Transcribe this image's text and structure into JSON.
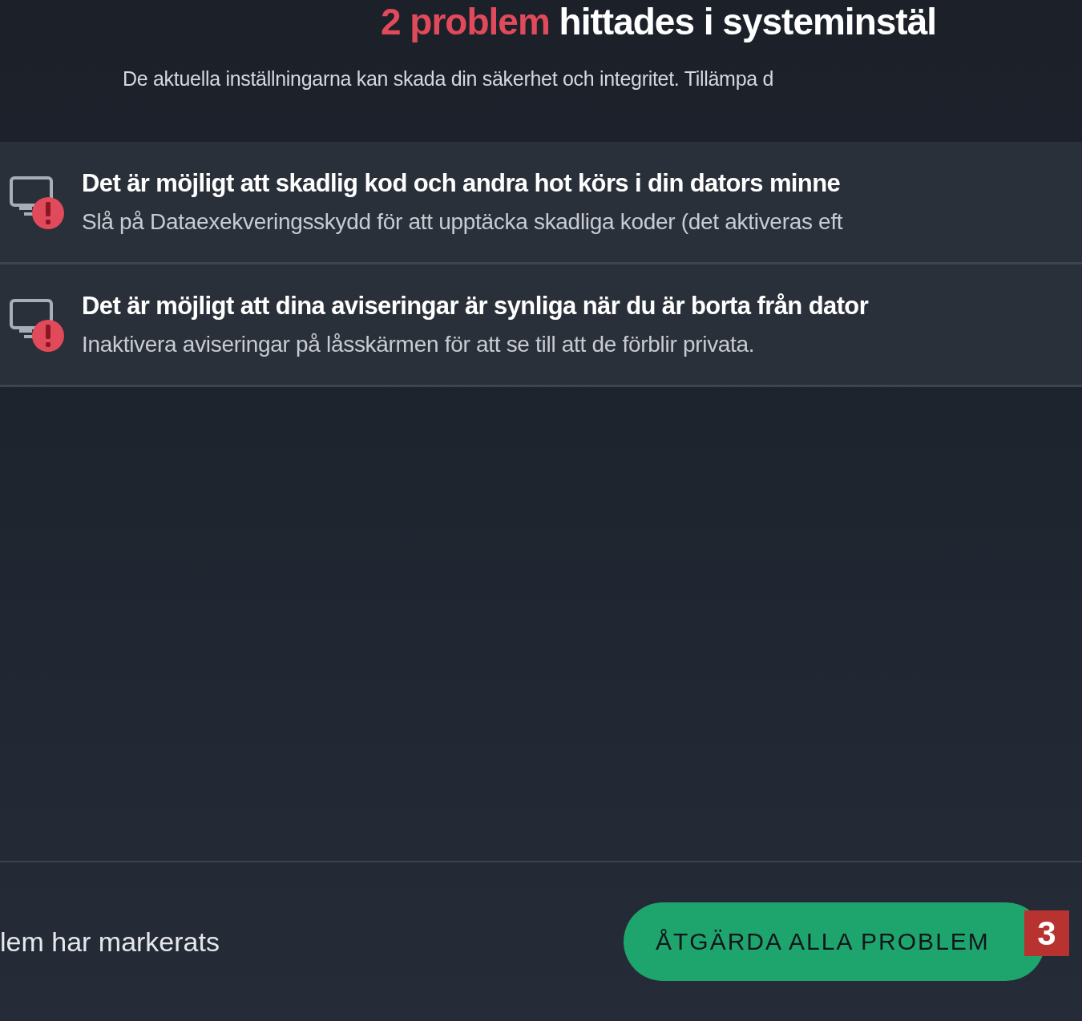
{
  "header": {
    "count": "2 problem",
    "title": "hittades i systeminstäl",
    "subtitle": "De aktuella inställningarna kan skada din säkerhet och integritet. Tillämpa d"
  },
  "problems": [
    {
      "title": "Det är möjligt att skadlig kod och andra hot körs i din dators minne",
      "description": "Slå på Dataexekveringsskydd för att upptäcka skadliga koder (det aktiveras eft"
    },
    {
      "title": "Det är möjligt att dina aviseringar är synliga när du är borta från dator",
      "description": "Inaktivera aviseringar på låsskärmen för att se till att de förblir privata."
    }
  ],
  "footer": {
    "status": "lem har markerats",
    "button": "ÅTGÄRDA ALLA PROBLEM",
    "callout": "3"
  }
}
